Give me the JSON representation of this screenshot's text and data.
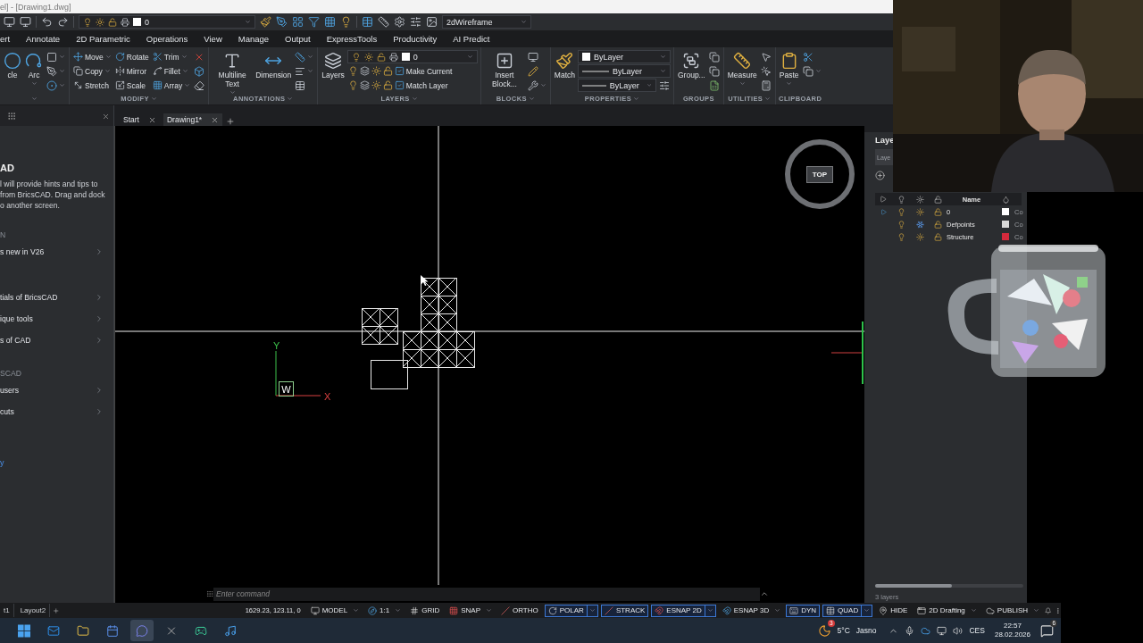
{
  "title_bar": {
    "title": "el] - [Drawing1.dwg]"
  },
  "quick_access": {
    "layer_value": "0",
    "visual_style": "2dWireframe"
  },
  "ribbon_tabs": [
    "ert",
    "Annotate",
    "2D Parametric",
    "Operations",
    "View",
    "Manage",
    "Output",
    "ExpressTools",
    "Productivity",
    "AI Predict"
  ],
  "ribbon_panels": [
    {
      "caret": true,
      "columns": [
        [
          {
            "kind": "large",
            "label": "cle",
            "caret": false
          }
        ],
        [
          {
            "kind": "large",
            "label": "Arc",
            "caret": true
          }
        ],
        [
          {
            "kind": "icon",
            "caret": true
          },
          {
            "kind": "icon",
            "caret": true
          },
          {
            "kind": "icon",
            "caret": true
          }
        ]
      ]
    },
    {
      "label": "MODIFY",
      "caret": true,
      "columns": [
        [
          {
            "kind": "small",
            "label": "Move",
            "caret": true
          },
          {
            "kind": "small",
            "label": "Copy",
            "caret": true
          },
          {
            "kind": "small",
            "label": "Stretch",
            "caret": false
          }
        ],
        [
          {
            "kind": "small",
            "label": "Rotate",
            "caret": false
          },
          {
            "kind": "small",
            "label": "Mirror",
            "caret": false
          },
          {
            "kind": "small",
            "label": "Scale",
            "caret": false
          }
        ],
        [
          {
            "kind": "small",
            "label": "Trim",
            "caret": true
          },
          {
            "kind": "small",
            "label": "Fillet",
            "caret": true
          },
          {
            "kind": "small",
            "label": "Array",
            "caret": true
          }
        ],
        [
          {
            "kind": "icon",
            "caret": false
          },
          {
            "kind": "icon",
            "caret": false
          },
          {
            "kind": "icon",
            "caret": false
          }
        ]
      ]
    },
    {
      "label": "ANNOTATIONS",
      "caret": true,
      "columns": [
        [
          {
            "kind": "large",
            "label": "Multiline Text",
            "caret": true
          }
        ],
        [
          {
            "kind": "large",
            "label": "Dimension",
            "caret": false
          }
        ],
        [
          {
            "kind": "icon",
            "caret": true
          },
          {
            "kind": "icon",
            "caret": true
          },
          {
            "kind": "icon",
            "caret": false
          }
        ]
      ]
    },
    {
      "label": "LAYERS",
      "caret": true,
      "columns": [
        [
          {
            "kind": "large",
            "label": "Layers",
            "caret": false
          }
        ],
        [
          {
            "kind": "combo",
            "value": "0"
          },
          {
            "kind": "icons_label",
            "label": "Make Current"
          },
          {
            "kind": "icons_label",
            "label": "Match Layer"
          }
        ]
      ]
    },
    {
      "label": "BLOCKS",
      "caret": true,
      "columns": [
        [
          {
            "kind": "large",
            "label": "Insert Block...",
            "caret": false
          }
        ],
        [
          {
            "kind": "icon",
            "caret": false
          },
          {
            "kind": "icon",
            "caret": false
          },
          {
            "kind": "icon",
            "caret": true
          }
        ]
      ]
    },
    {
      "label": "PROPERTIES",
      "caret": true,
      "columns": [
        [
          {
            "kind": "large",
            "label": "Match",
            "caret": false
          }
        ],
        [
          {
            "kind": "color_combo",
            "value": "ByLayer",
            "settings": false
          },
          {
            "kind": "line_combo",
            "value": "ByLayer",
            "settings": false
          },
          {
            "kind": "line_combo",
            "value": "ByLayer",
            "settings": true
          }
        ]
      ]
    },
    {
      "label": "GROUPS",
      "caret": false,
      "columns": [
        [
          {
            "kind": "large",
            "label": "Group...",
            "caret": false
          }
        ],
        [
          {
            "kind": "icon",
            "caret": false
          },
          {
            "kind": "icon",
            "caret": false
          },
          {
            "kind": "icon",
            "caret": false
          }
        ]
      ]
    },
    {
      "label": "UTILITIES",
      "caret": true,
      "columns": [
        [
          {
            "kind": "large",
            "label": "Measure",
            "caret": true
          }
        ],
        [
          {
            "kind": "icon",
            "caret": false
          },
          {
            "kind": "icon",
            "caret": false
          },
          {
            "kind": "icon",
            "caret": false
          }
        ]
      ]
    },
    {
      "label": "CLIPBOARD",
      "caret": false,
      "columns": [
        [
          {
            "kind": "large",
            "label": "Paste",
            "caret": true
          }
        ],
        [
          {
            "kind": "icon",
            "caret": false
          },
          {
            "kind": "icon",
            "caret": true
          }
        ]
      ]
    }
  ],
  "help_panel": {
    "title": "AD",
    "text_lines": [
      "l will provide hints and tips to",
      "from BricsCAD. Drag and dock",
      "o another screen."
    ],
    "sections": [
      {
        "heading": "N",
        "items": [
          "s new in V26"
        ]
      },
      {
        "items": [
          "tials of BricsCAD",
          "ique tools",
          "s of CAD"
        ]
      },
      {
        "heading": "SCAD",
        "items": [
          "users",
          "cuts"
        ]
      }
    ],
    "link": "y"
  },
  "doc_tabs": [
    {
      "label": "Start",
      "selected": false
    },
    {
      "label": "Drawing1*",
      "selected": true
    }
  ],
  "canvas": {
    "view_cube": "TOP",
    "ucs": {
      "y": "Y",
      "x": "X",
      "w": "W"
    },
    "command_placeholder": "Enter command"
  },
  "layers_panel": {
    "title": "Laye",
    "search_placeholder": "Laye",
    "header": "Name",
    "rows": [
      {
        "name": "0",
        "current": true,
        "frozen": false,
        "color": "#ffffff",
        "column_7": "Co"
      },
      {
        "name": "Defpoints",
        "current": false,
        "frozen": true,
        "color": "#d8d8d8",
        "column_7": "Co"
      },
      {
        "name": "Structure",
        "current": false,
        "frozen": false,
        "color": "#d42a3c",
        "column_7": "Co"
      }
    ],
    "count": "3 layers"
  },
  "status_bar": {
    "layout_tabs": [
      "t1",
      "Layout2"
    ],
    "coordinates": "1629.23, 123.11, 0",
    "toggles": [
      {
        "label": "MODEL",
        "on": false,
        "caret": true
      },
      {
        "label": "1:1",
        "on": false,
        "caret": true
      },
      {
        "label": "GRID",
        "on": false,
        "caret": false
      },
      {
        "label": "SNAP",
        "on": false,
        "caret": true
      },
      {
        "label": "ORTHO",
        "on": false,
        "caret": false
      },
      {
        "label": "POLAR",
        "on": true,
        "caret": true
      },
      {
        "label": "STRACK",
        "on": true,
        "caret": false
      },
      {
        "label": "ESNAP 2D",
        "on": true,
        "caret": true
      },
      {
        "label": "ESNAP 3D",
        "on": false,
        "caret": true
      },
      {
        "label": "DYN",
        "on": true,
        "caret": false
      },
      {
        "label": "QUAD",
        "on": true,
        "caret": true
      },
      {
        "label": "HIDE",
        "on": false,
        "caret": false
      },
      {
        "label": "2D Drafting",
        "on": false,
        "caret": true
      },
      {
        "label": "PUBLISH",
        "on": false,
        "caret": true
      }
    ]
  },
  "taskbar": {
    "apps": [
      {
        "selected": false
      },
      {
        "selected": false
      },
      {
        "selected": false
      },
      {
        "selected": false
      },
      {
        "selected": true
      },
      {
        "selected": false
      },
      {
        "selected": false
      },
      {
        "selected": false
      }
    ],
    "weather": {
      "badge": "3",
      "temperature": "5°C",
      "condition": "Jasno"
    },
    "language": "CES",
    "time": "22:57",
    "date": "28.02.2026",
    "notifications": "6"
  }
}
